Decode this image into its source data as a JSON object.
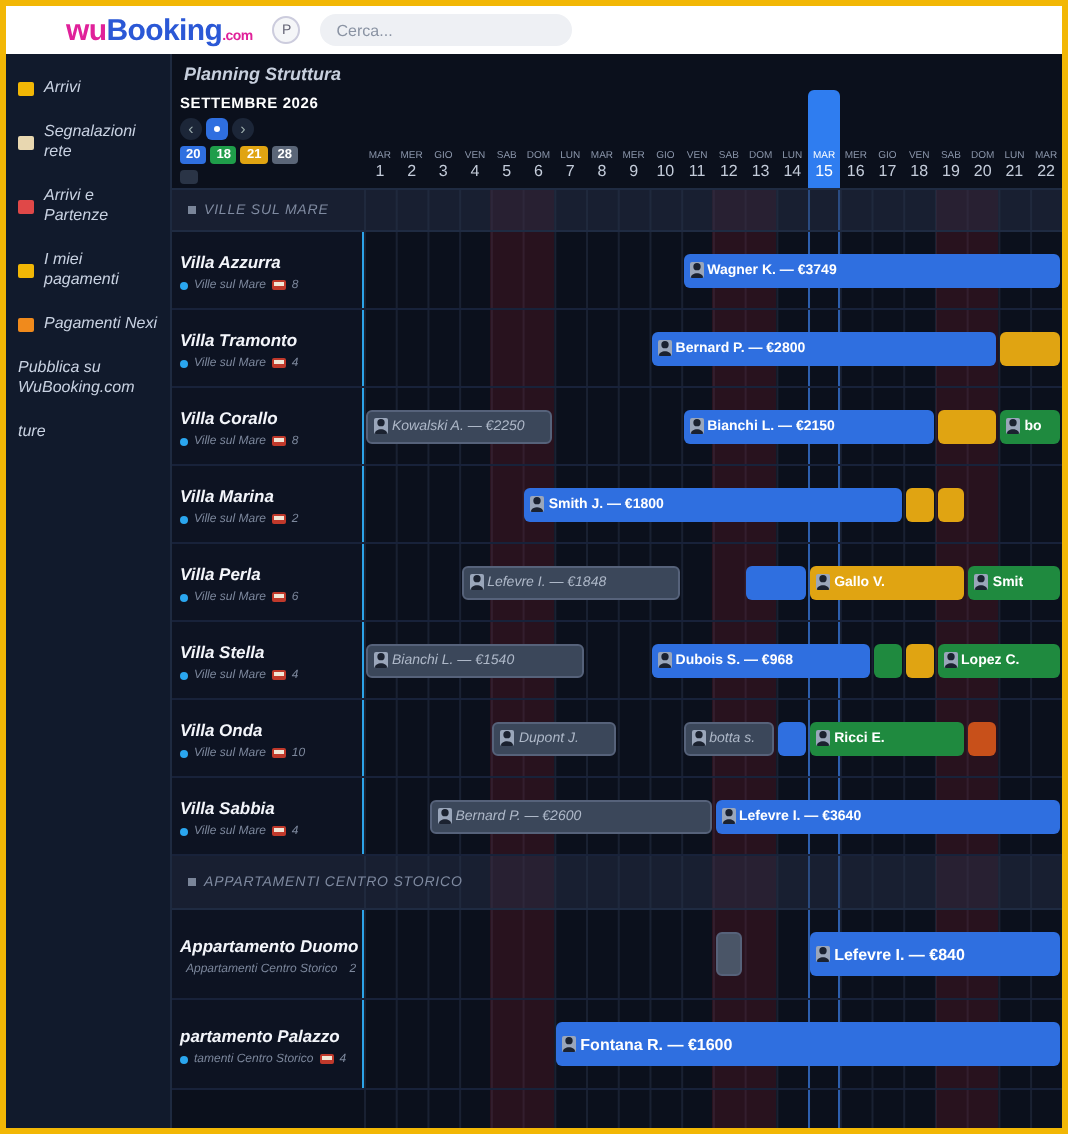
{
  "topbar": {
    "logo": {
      "prefix": "wu",
      "name": "Booking",
      "suffix": ".com"
    },
    "profile_button": "P",
    "search": {
      "placeholder": "Cerca..."
    }
  },
  "sidebar": {
    "items": [
      {
        "label": "Arrivi",
        "color": "#f2b705"
      },
      {
        "label": "Segnalazioni rete",
        "color": "#e8d7b0"
      },
      {
        "label": "Arrivi e Partenze",
        "color": "#e04848"
      },
      {
        "label": "I miei pagamenti",
        "color": "#f2b705"
      },
      {
        "label": "Pagamenti Nexi",
        "color": "#f08a1c"
      },
      {
        "label": "Pubblica su WuBooking.com"
      },
      {
        "label": "ture"
      }
    ]
  },
  "planner": {
    "title": "Planning Struttura",
    "month": "SETTEMBRE 2026",
    "nav": {
      "prev": "‹",
      "next": "›"
    },
    "badges": [
      {
        "label": "20",
        "color": "#2f6fe0"
      },
      {
        "label": "18",
        "color": "#1f9d4a"
      },
      {
        "label": "21",
        "color": "#e0a412"
      },
      {
        "label": "28",
        "color": "#5b6678"
      }
    ],
    "days": [
      {
        "weekday": "MAR",
        "day": "1",
        "weekend": false,
        "selected": false
      },
      {
        "weekday": "MER",
        "day": "2",
        "weekend": false,
        "selected": false
      },
      {
        "weekday": "GIO",
        "day": "3",
        "weekend": false,
        "selected": false
      },
      {
        "weekday": "VEN",
        "day": "4",
        "weekend": false,
        "selected": false
      },
      {
        "weekday": "SAB",
        "day": "5",
        "weekend": true,
        "selected": false
      },
      {
        "weekday": "DOM",
        "day": "6",
        "weekend": true,
        "selected": false
      },
      {
        "weekday": "LUN",
        "day": "7",
        "weekend": false,
        "selected": false
      },
      {
        "weekday": "MAR",
        "day": "8",
        "weekend": false,
        "selected": false
      },
      {
        "weekday": "MER",
        "day": "9",
        "weekend": false,
        "selected": false
      },
      {
        "weekday": "GIO",
        "day": "10",
        "weekend": false,
        "selected": false
      },
      {
        "weekday": "VEN",
        "day": "11",
        "weekend": false,
        "selected": false
      },
      {
        "weekday": "SAB",
        "day": "12",
        "weekend": true,
        "selected": false
      },
      {
        "weekday": "DOM",
        "day": "13",
        "weekend": true,
        "selected": false
      },
      {
        "weekday": "LUN",
        "day": "14",
        "weekend": false,
        "selected": false
      },
      {
        "weekday": "MAR",
        "day": "15",
        "weekend": false,
        "selected": true
      },
      {
        "weekday": "MER",
        "day": "16",
        "weekend": false,
        "selected": false
      },
      {
        "weekday": "GIO",
        "day": "17",
        "weekend": false,
        "selected": false
      },
      {
        "weekday": "VEN",
        "day": "18",
        "weekend": false,
        "selected": false
      },
      {
        "weekday": "SAB",
        "day": "19",
        "weekend": true,
        "selected": false
      },
      {
        "weekday": "DOM",
        "day": "20",
        "weekend": true,
        "selected": false
      },
      {
        "weekday": "LUN",
        "day": "21",
        "weekend": false,
        "selected": false
      },
      {
        "weekday": "MAR",
        "day": "22",
        "weekend": false,
        "selected": false
      }
    ],
    "groups": [
      {
        "label": "VILLE SUL MARE",
        "units": [
          {
            "name": "Villa Azzurra",
            "category": "Ville sul Mare",
            "beds": "8",
            "cells": [
              {
                "kind": "free"
              },
              {
                "kind": "free"
              },
              {
                "kind": "free"
              },
              {
                "kind": "free"
              },
              {
                "kind": "free"
              },
              {
                "kind": "free"
              },
              {
                "kind": "free"
              },
              {
                "kind": "free"
              },
              {
                "kind": "free"
              },
              {
                "kind": "free"
              },
              {
                "kind": "booking",
                "color": "#2f6fe0",
                "guest": "Wagner K. — €3749"
              },
              {
                "kind": "cont"
              },
              {
                "kind": "cont"
              },
              {
                "kind": "cont"
              },
              {
                "kind": "cont"
              },
              {
                "kind": "cont"
              },
              {
                "kind": "cont"
              },
              {
                "kind": "cont"
              },
              {
                "kind": "cont"
              },
              {
                "kind": "cont"
              },
              {
                "kind": "cont"
              },
              {
                "kind": "cont"
              }
            ]
          },
          {
            "name": "Villa Tramonto",
            "category": "Ville sul Mare",
            "beds": "4",
            "cells": [
              {
                "kind": "free"
              },
              {
                "kind": "free"
              },
              {
                "kind": "free"
              },
              {
                "kind": "free"
              },
              {
                "kind": "free"
              },
              {
                "kind": "free"
              },
              {
                "kind": "free"
              },
              {
                "kind": "free"
              },
              {
                "kind": "free"
              },
              {
                "kind": "booking",
                "color": "#2f6fe0",
                "guest": "Bernard P. — €2800"
              },
              {
                "kind": "cont"
              },
              {
                "kind": "cont"
              },
              {
                "kind": "cont"
              },
              {
                "kind": "cont"
              },
              {
                "kind": "cont"
              },
              {
                "kind": "cont"
              },
              {
                "kind": "cont"
              },
              {
                "kind": "cont"
              },
              {
                "kind": "cont"
              },
              {
                "kind": "cont"
              },
              {
                "kind": "booking",
                "color": "#e0a412"
              },
              {
                "kind": "cont"
              }
            ]
          },
          {
            "name": "Villa Corallo",
            "category": "Ville sul Mare",
            "beds": "8",
            "cells": [
              {
                "kind": "option",
                "color": "#3b475a",
                "guest": "Kowalski A. — €2250"
              },
              {
                "kind": "cont"
              },
              {
                "kind": "cont"
              },
              {
                "kind": "cont"
              },
              {
                "kind": "cont"
              },
              {
                "kind": "cont"
              },
              {
                "kind": "free"
              },
              {
                "kind": "free"
              },
              {
                "kind": "free"
              },
              {
                "kind": "free"
              },
              {
                "kind": "booking",
                "color": "#2f6fe0",
                "guest": "Bianchi L. — €2150"
              },
              {
                "kind": "cont"
              },
              {
                "kind": "cont"
              },
              {
                "kind": "cont"
              },
              {
                "kind": "cont"
              },
              {
                "kind": "cont"
              },
              {
                "kind": "cont"
              },
              {
                "kind": "cont"
              },
              {
                "kind": "booking",
                "color": "#e0a412"
              },
              {
                "kind": "cont"
              },
              {
                "kind": "booking",
                "color": "#1f8a3f",
                "guest": "bo"
              },
              {
                "kind": "cont"
              }
            ]
          },
          {
            "name": "Villa Marina",
            "category": "Ville sul Mare",
            "beds": "2",
            "cells": [
              {
                "kind": "free"
              },
              {
                "kind": "free"
              },
              {
                "kind": "free"
              },
              {
                "kind": "free"
              },
              {
                "kind": "free"
              },
              {
                "kind": "booking",
                "color": "#2f6fe0",
                "guest": "Smith J. — €1800"
              },
              {
                "kind": "cont"
              },
              {
                "kind": "cont"
              },
              {
                "kind": "cont"
              },
              {
                "kind": "cont"
              },
              {
                "kind": "cont"
              },
              {
                "kind": "cont"
              },
              {
                "kind": "cont"
              },
              {
                "kind": "cont"
              },
              {
                "kind": "cont"
              },
              {
                "kind": "cont"
              },
              {
                "kind": "cont"
              },
              {
                "kind": "booking",
                "color": "#e0a412"
              },
              {
                "kind": "booking",
                "color": "#e0a412"
              },
              {
                "kind": "free"
              },
              {
                "kind": "free"
              },
              {
                "kind": "free"
              }
            ]
          },
          {
            "name": "Villa Perla",
            "category": "Ville sul Mare",
            "beds": "6",
            "cells": [
              {
                "kind": "free"
              },
              {
                "kind": "free"
              },
              {
                "kind": "free"
              },
              {
                "kind": "option",
                "color": "#3b475a",
                "guest": "Lefevre I. — €1848"
              },
              {
                "kind": "cont"
              },
              {
                "kind": "cont"
              },
              {
                "kind": "cont"
              },
              {
                "kind": "cont"
              },
              {
                "kind": "cont"
              },
              {
                "kind": "cont"
              },
              {
                "kind": "free"
              },
              {
                "kind": "free"
              },
              {
                "kind": "booking",
                "color": "#2f6fe0"
              },
              {
                "kind": "cont"
              },
              {
                "kind": "booking",
                "color": "#e0a412",
                "guest": "Gallo V."
              },
              {
                "kind": "cont"
              },
              {
                "kind": "cont"
              },
              {
                "kind": "cont"
              },
              {
                "kind": "cont"
              },
              {
                "kind": "booking",
                "color": "#1f8a3f",
                "guest": "Smit"
              },
              {
                "kind": "cont"
              },
              {
                "kind": "cont"
              }
            ]
          },
          {
            "name": "Villa Stella",
            "category": "Ville sul Mare",
            "beds": "4",
            "cells": [
              {
                "kind": "option",
                "color": "#3b475a",
                "guest": "Bianchi L. — €1540"
              },
              {
                "kind": "cont"
              },
              {
                "kind": "cont"
              },
              {
                "kind": "cont"
              },
              {
                "kind": "cont"
              },
              {
                "kind": "cont"
              },
              {
                "kind": "cont"
              },
              {
                "kind": "free"
              },
              {
                "kind": "free"
              },
              {
                "kind": "booking",
                "color": "#2f6fe0",
                "guest": "Dubois S. — €968"
              },
              {
                "kind": "cont"
              },
              {
                "kind": "cont"
              },
              {
                "kind": "cont"
              },
              {
                "kind": "cont"
              },
              {
                "kind": "cont"
              },
              {
                "kind": "cont"
              },
              {
                "kind": "booking",
                "color": "#1f8a3f"
              },
              {
                "kind": "booking",
                "color": "#e0a412"
              },
              {
                "kind": "booking",
                "color": "#1f8a3f",
                "guest": "Lopez C."
              },
              {
                "kind": "cont"
              },
              {
                "kind": "cont"
              },
              {
                "kind": "cont"
              }
            ]
          },
          {
            "name": "Villa Onda",
            "category": "Ville sul Mare",
            "beds": "10",
            "cells": [
              {
                "kind": "free"
              },
              {
                "kind": "free"
              },
              {
                "kind": "free"
              },
              {
                "kind": "free"
              },
              {
                "kind": "option",
                "color": "#3b475a",
                "guest": "Dupont J."
              },
              {
                "kind": "cont"
              },
              {
                "kind": "cont"
              },
              {
                "kind": "cont"
              },
              {
                "kind": "free"
              },
              {
                "kind": "free"
              },
              {
                "kind": "option",
                "color": "#3b475a",
                "guest": "botta s."
              },
              {
                "kind": "cont"
              },
              {
                "kind": "cont"
              },
              {
                "kind": "booking",
                "color": "#2f6fe0"
              },
              {
                "kind": "booking",
                "color": "#1f8a3f",
                "guest": "Ricci E."
              },
              {
                "kind": "cont"
              },
              {
                "kind": "cont"
              },
              {
                "kind": "cont"
              },
              {
                "kind": "cont"
              },
              {
                "kind": "booking",
                "color": "#c8501a"
              },
              {
                "kind": "free"
              },
              {
                "kind": "free"
              }
            ]
          },
          {
            "name": "Villa Sabbia",
            "category": "Ville sul Mare",
            "beds": "4",
            "cells": [
              {
                "kind": "free"
              },
              {
                "kind": "free"
              },
              {
                "kind": "option",
                "color": "#3b475a",
                "guest": "Bernard P. — €2600"
              },
              {
                "kind": "cont"
              },
              {
                "kind": "cont"
              },
              {
                "kind": "cont"
              },
              {
                "kind": "cont"
              },
              {
                "kind": "cont"
              },
              {
                "kind": "cont"
              },
              {
                "kind": "cont"
              },
              {
                "kind": "cont"
              },
              {
                "kind": "booking",
                "color": "#2f6fe0",
                "guest": "Lefevre I. — €3640"
              },
              {
                "kind": "cont"
              },
              {
                "kind": "cont"
              },
              {
                "kind": "cont"
              },
              {
                "kind": "cont"
              },
              {
                "kind": "cont"
              },
              {
                "kind": "cont"
              },
              {
                "kind": "cont"
              },
              {
                "kind": "cont"
              },
              {
                "kind": "cont"
              },
              {
                "kind": "cont"
              }
            ]
          }
        ]
      },
      {
        "label": "APPARTAMENTI CENTRO STORICO",
        "units": [
          {
            "name": "Appartamento Duomo",
            "category": "Appartamenti Centro Storico",
            "beds": "2",
            "cells": [
              {
                "kind": "free"
              },
              {
                "kind": "free"
              },
              {
                "kind": "free"
              },
              {
                "kind": "free"
              },
              {
                "kind": "free"
              },
              {
                "kind": "free"
              },
              {
                "kind": "free"
              },
              {
                "kind": "free"
              },
              {
                "kind": "free"
              },
              {
                "kind": "free"
              },
              {
                "kind": "free"
              },
              {
                "kind": "option",
                "color": "#4a5567"
              },
              {
                "kind": "free"
              },
              {
                "kind": "free"
              },
              {
                "kind": "booking",
                "color": "#2f6fe0",
                "guest": "Lefevre I. — €840"
              },
              {
                "kind": "cont"
              },
              {
                "kind": "cont"
              },
              {
                "kind": "cont"
              },
              {
                "kind": "cont"
              },
              {
                "kind": "cont"
              },
              {
                "kind": "cont"
              },
              {
                "kind": "cont"
              }
            ]
          },
          {
            "name": "partamento Palazzo",
            "category": "tamenti Centro Storico",
            "beds": "4",
            "cells": [
              {
                "kind": "free"
              },
              {
                "kind": "free"
              },
              {
                "kind": "free"
              },
              {
                "kind": "free"
              },
              {
                "kind": "free"
              },
              {
                "kind": "free"
              },
              {
                "kind": "booking",
                "color": "#2f6fe0",
                "guest": "Fontana R. — €1600"
              },
              {
                "kind": "cont"
              },
              {
                "kind": "cont"
              },
              {
                "kind": "cont"
              },
              {
                "kind": "cont"
              },
              {
                "kind": "cont"
              },
              {
                "kind": "cont"
              },
              {
                "kind": "cont"
              },
              {
                "kind": "cont"
              },
              {
                "kind": "cont"
              },
              {
                "kind": "cont"
              },
              {
                "kind": "cont"
              },
              {
                "kind": "cont"
              },
              {
                "kind": "cont"
              },
              {
                "kind": "cont"
              },
              {
                "kind": "cont"
              }
            ]
          }
        ]
      }
    ]
  }
}
